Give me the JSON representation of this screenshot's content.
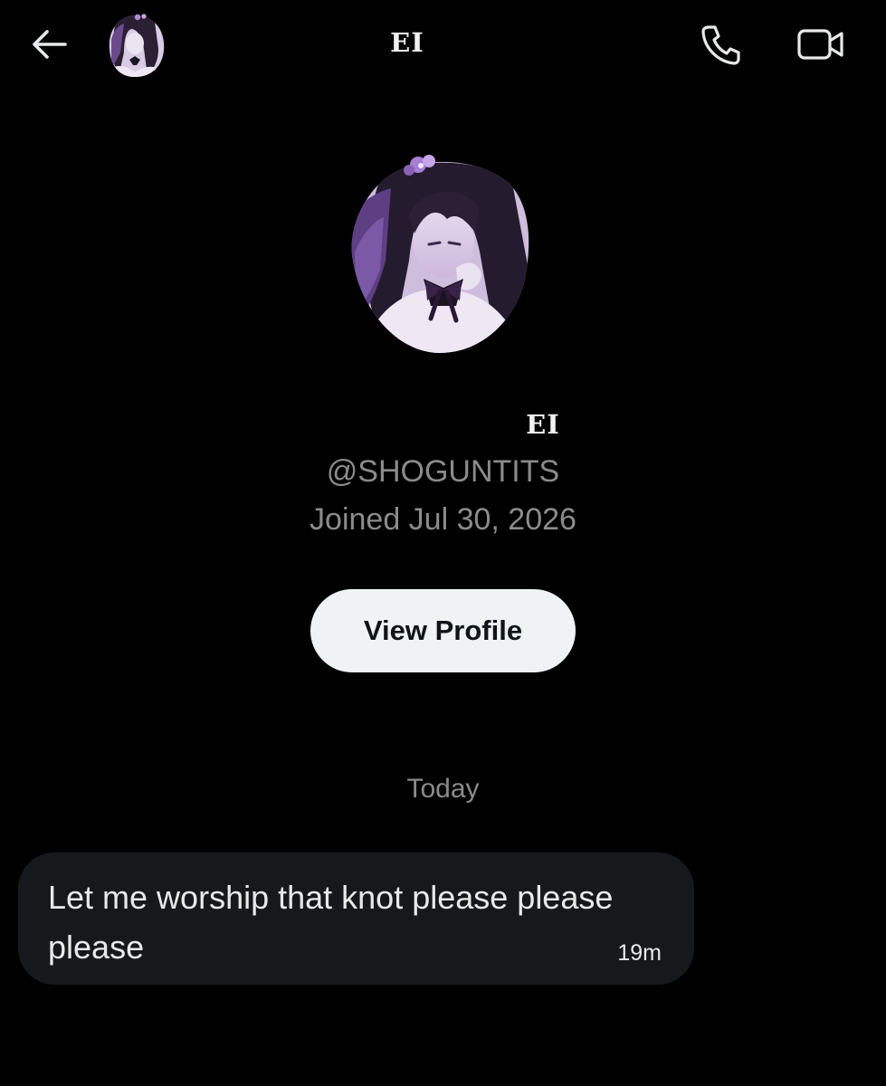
{
  "header": {
    "title": "EI",
    "back_icon": "arrow-left-icon",
    "call_icon": "phone-icon",
    "video_icon": "video-camera-icon"
  },
  "profile": {
    "name": "EI",
    "handle": "@SHOGUNTITS",
    "joined": "Joined Jul 30, 2026",
    "view_profile_label": "View Profile"
  },
  "conversation": {
    "date_divider": "Today",
    "messages": [
      {
        "text": "Let me worship that knot please please please",
        "time": "19m"
      }
    ]
  },
  "colors": {
    "background": "#000000",
    "bubble": "#16181c",
    "muted_text": "#8b8b8b",
    "button_bg": "#eff3f4",
    "avatar_accent": "#5b3d7a"
  }
}
